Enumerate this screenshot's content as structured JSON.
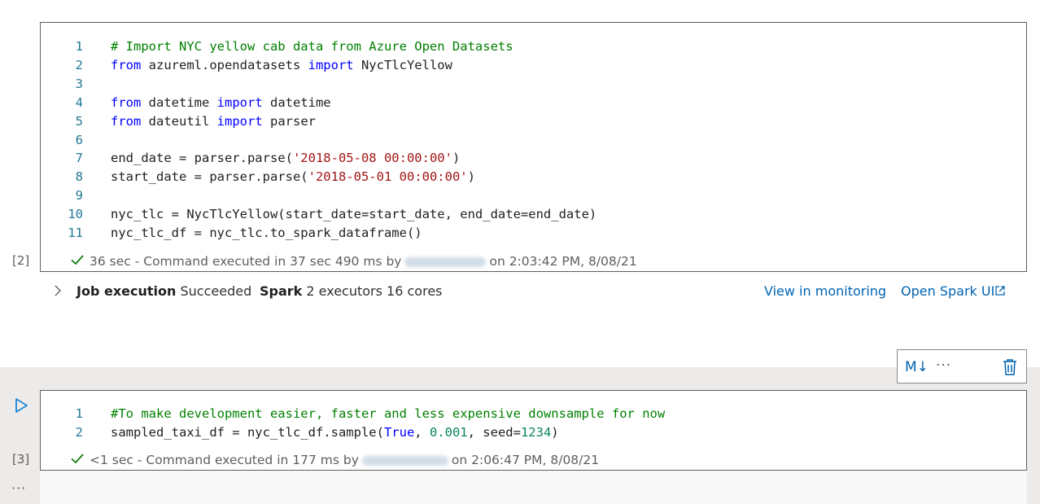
{
  "cell2": {
    "exec_count": "[2]",
    "lines": [
      {
        "n": "1",
        "tokens": [
          {
            "t": "# Import NYC yellow cab data from Azure Open Datasets",
            "c": "cm"
          }
        ]
      },
      {
        "n": "2",
        "tokens": [
          {
            "t": "from",
            "c": "kw"
          },
          {
            "t": " azureml.opendatasets ",
            "c": "id"
          },
          {
            "t": "import",
            "c": "kw"
          },
          {
            "t": " NycTlcYellow",
            "c": "id"
          }
        ]
      },
      {
        "n": "3",
        "tokens": []
      },
      {
        "n": "4",
        "tokens": [
          {
            "t": "from",
            "c": "kw"
          },
          {
            "t": " datetime ",
            "c": "id"
          },
          {
            "t": "import",
            "c": "kw"
          },
          {
            "t": " datetime",
            "c": "id"
          }
        ]
      },
      {
        "n": "5",
        "tokens": [
          {
            "t": "from",
            "c": "kw"
          },
          {
            "t": " dateutil ",
            "c": "id"
          },
          {
            "t": "import",
            "c": "kw"
          },
          {
            "t": " parser",
            "c": "id"
          }
        ]
      },
      {
        "n": "6",
        "tokens": []
      },
      {
        "n": "7",
        "tokens": [
          {
            "t": "end_date = parser.parse(",
            "c": "id"
          },
          {
            "t": "'2018-05-08 00:00:00'",
            "c": "str"
          },
          {
            "t": ")",
            "c": "id"
          }
        ]
      },
      {
        "n": "8",
        "tokens": [
          {
            "t": "start_date = parser.parse(",
            "c": "id"
          },
          {
            "t": "'2018-05-01 00:00:00'",
            "c": "str"
          },
          {
            "t": ")",
            "c": "id"
          }
        ]
      },
      {
        "n": "9",
        "tokens": []
      },
      {
        "n": "10",
        "tokens": [
          {
            "t": "nyc_tlc = NycTlcYellow(start_date=start_date, end_date=end_date)",
            "c": "id"
          }
        ]
      },
      {
        "n": "11",
        "tokens": [
          {
            "t": "nyc_tlc_df = nyc_tlc.to_spark_dataframe()",
            "c": "id"
          }
        ]
      }
    ],
    "status": {
      "duration": "36 sec",
      "sep": " - ",
      "text": "Command executed in 37 sec 490 ms by",
      "suffix": "on 2:03:42 PM, 8/08/21"
    }
  },
  "job": {
    "label": "Job execution",
    "state": "Succeeded",
    "spark_label": "Spark",
    "spark_info": "2 executors 16 cores",
    "monitor_link": "View in monitoring",
    "spark_ui_link": "Open Spark UI"
  },
  "toolbar": {
    "md_label": "M↓",
    "more_label": "···"
  },
  "cell3": {
    "exec_count": "[3]",
    "lines": [
      {
        "n": "1",
        "tokens": [
          {
            "t": "#To make development easier, faster and less expensive downsample for now",
            "c": "cm"
          }
        ]
      },
      {
        "n": "2",
        "tokens": [
          {
            "t": "sampled_taxi_df = nyc_tlc_df.sample(",
            "c": "id"
          },
          {
            "t": "True",
            "c": "kw"
          },
          {
            "t": ", ",
            "c": "id"
          },
          {
            "t": "0.001",
            "c": "num"
          },
          {
            "t": ", seed=",
            "c": "id"
          },
          {
            "t": "1234",
            "c": "num"
          },
          {
            "t": ")",
            "c": "id"
          }
        ]
      }
    ],
    "status": {
      "duration": "<1 sec",
      "sep": " - ",
      "text": "Command executed in 177 ms by",
      "suffix": "on 2:06:47 PM, 8/08/21"
    }
  },
  "left_more": "···",
  "colors": {
    "keyword": "#0000ff",
    "comment": "#008000",
    "string": "#a31515",
    "number": "#098658",
    "line_number": "#237893",
    "link": "#0063b1",
    "check": "#107c10"
  }
}
